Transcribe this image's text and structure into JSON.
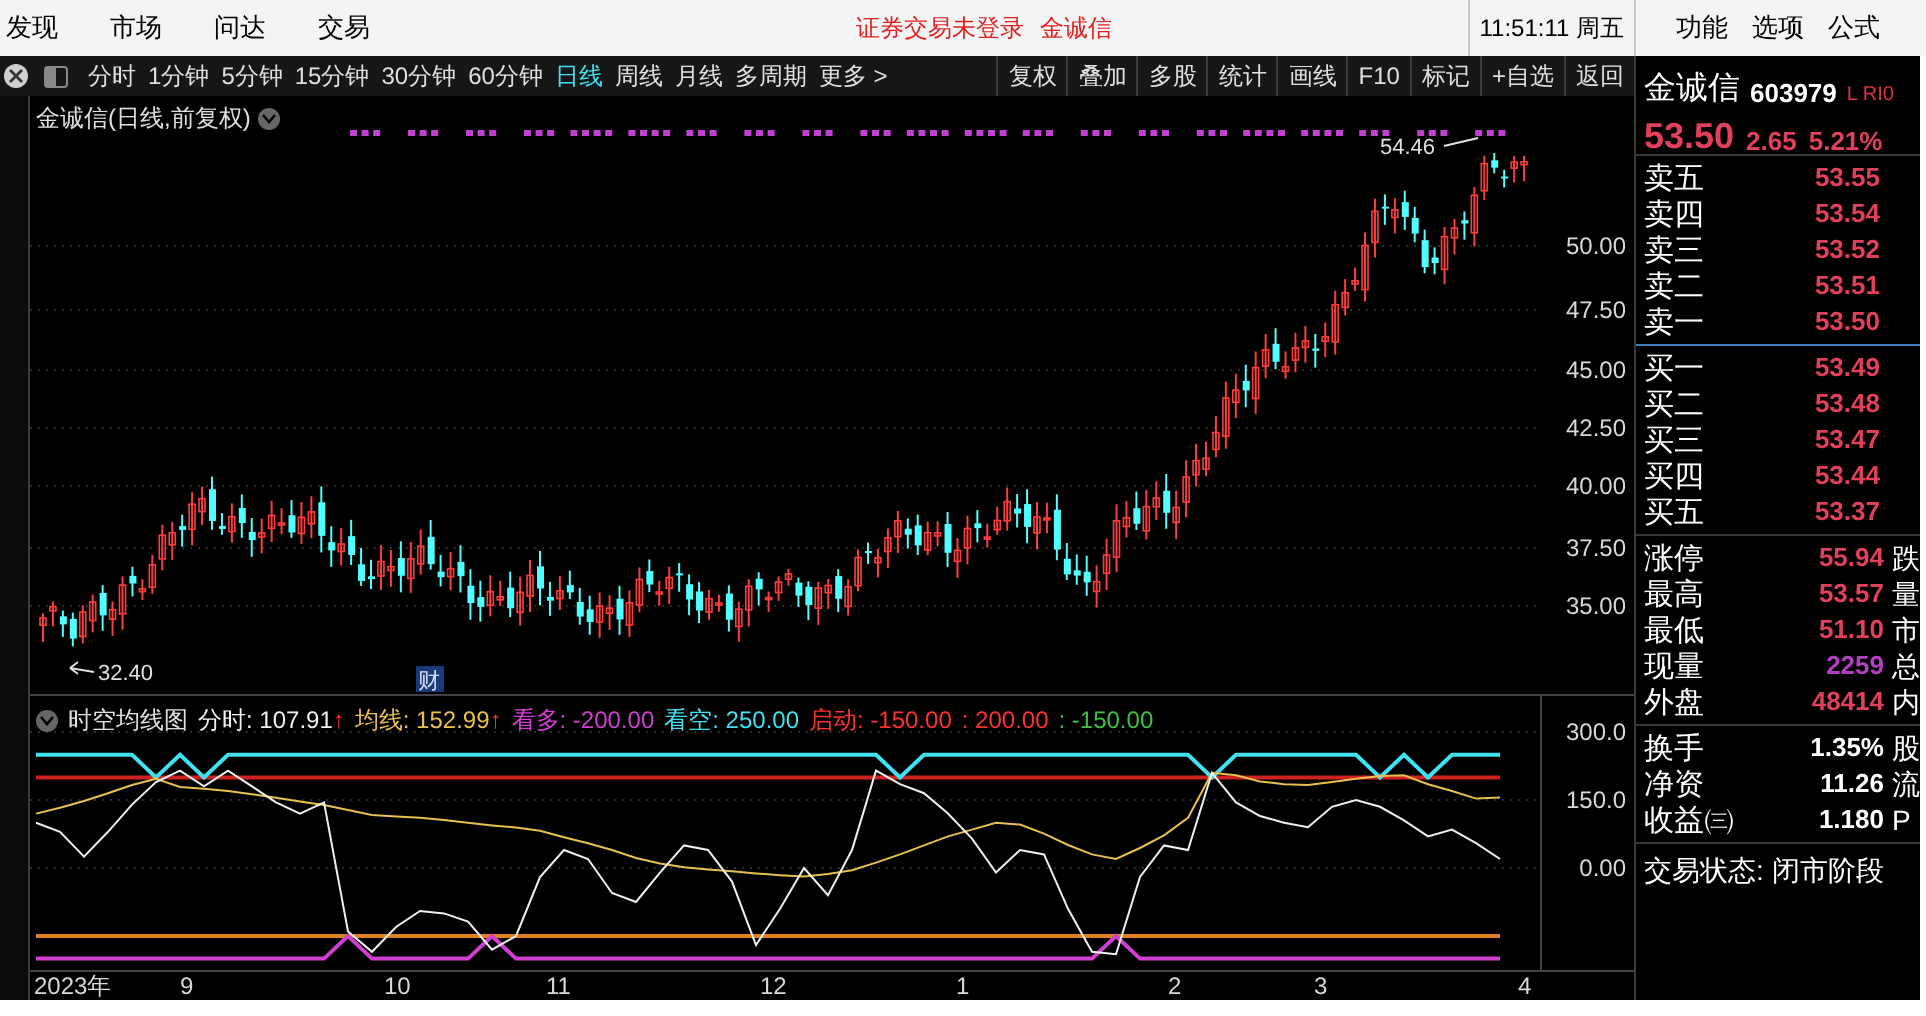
{
  "menu": {
    "items": [
      "发现",
      "市场",
      "问达",
      "交易"
    ]
  },
  "login_notice": "证券交易未登录",
  "login_stock": "金诚信",
  "clock": "11:51:11 周五",
  "top_actions": [
    "功能",
    "选项",
    "公式"
  ],
  "toolbar": {
    "periods": [
      {
        "label": "分时",
        "selected": false
      },
      {
        "label": "1分钟",
        "selected": false
      },
      {
        "label": "5分钟",
        "selected": false
      },
      {
        "label": "15分钟",
        "selected": false
      },
      {
        "label": "30分钟",
        "selected": false
      },
      {
        "label": "60分钟",
        "selected": false
      },
      {
        "label": "日线",
        "selected": true
      },
      {
        "label": "周线",
        "selected": false
      },
      {
        "label": "月线",
        "selected": false
      },
      {
        "label": "多周期",
        "selected": false
      },
      {
        "label": "更多 >",
        "selected": false
      }
    ],
    "buttons": [
      "复权",
      "叠加",
      "多股",
      "统计",
      "画线",
      "F10",
      "标记",
      "+自选",
      "返回"
    ]
  },
  "chart": {
    "title": "金诚信(日线,前复权)",
    "high_label": "54.46",
    "low_label": "32.40",
    "event_marker": "财",
    "price_axis": [
      "50.00",
      "47.50",
      "45.00",
      "42.50",
      "40.00",
      "37.50",
      "35.00"
    ],
    "indicator": {
      "name": "时空均线图",
      "legend": [
        {
          "value": ": 107.91",
          "arrow": "↑"
        },
        {
          "value": ": 152.99",
          "arrow": "↑"
        },
        {
          "value": ": -200.00"
        },
        {
          "value": ": 250.00"
        },
        {
          "value": ": -150.00"
        },
        {
          "text": ": 200.00",
          "color": "#ff3030"
        },
        {
          "text": ": -150.00",
          "color": "#40c040"
        }
      ]
    },
    "chart_data": {
      "type": "line",
      "grid": true,
      "ylim": [
        -225,
        384
      ],
      "yticks": [
        {
          "value": 300,
          "label": "300.0"
        },
        {
          "value": 150,
          "label": "150.0"
        },
        {
          "value": 0,
          "label": "0.00"
        }
      ],
      "series": [
        {
          "name": "分时",
          "color": "#f0f0f0",
          "values": [
            100,
            80,
            25,
            80,
            140,
            190,
            215,
            180,
            215,
            180,
            145,
            120,
            145,
            -140,
            -185,
            -130,
            -95,
            -100,
            -118,
            -180,
            -150,
            -20,
            40,
            20,
            -55,
            -75,
            -10,
            50,
            40,
            -30,
            -170,
            -90,
            0,
            -60,
            40,
            215,
            185,
            165,
            120,
            65,
            -10,
            40,
            30,
            -90,
            -185,
            -190,
            -20,
            50,
            40,
            210,
            145,
            115,
            100,
            90,
            135,
            150,
            135,
            105,
            70,
            85,
            55,
            20
          ]
        },
        {
          "name": "均线",
          "color": "#e8c050",
          "values": [
            120,
            133,
            148,
            165,
            183,
            197,
            179,
            175,
            170,
            163,
            155,
            147,
            139,
            128,
            117,
            114,
            111,
            106,
            100,
            94,
            89,
            82,
            68,
            55,
            40,
            22,
            10,
            2,
            -3,
            -7,
            -12,
            -16,
            -19,
            -13,
            -5,
            12,
            30,
            50,
            70,
            85,
            100,
            96,
            76,
            51,
            30,
            20,
            44,
            72,
            111,
            210,
            205,
            191,
            185,
            183,
            190,
            197,
            203,
            205,
            185,
            170,
            153,
            156
          ]
        },
        {
          "name": "看多",
          "color": "#d040d0",
          "values": [
            -200,
            -200,
            -200,
            -200,
            -200,
            -200,
            -200,
            -200,
            -200,
            -200,
            -200,
            -200,
            -200,
            -150,
            -200,
            -200,
            -200,
            -200,
            -200,
            -150,
            -200,
            -200,
            -200,
            -200,
            -200,
            -200,
            -200,
            -200,
            -200,
            -200,
            -200,
            -200,
            -200,
            -200,
            -200,
            -200,
            -200,
            -200,
            -200,
            -200,
            -200,
            -200,
            -200,
            -200,
            -200,
            -150,
            -200,
            -200,
            -200,
            -200,
            -200,
            -200,
            -200,
            -200,
            -200,
            -200,
            -200,
            -200,
            -200,
            -200,
            -200,
            -200
          ]
        },
        {
          "name": "看空",
          "color": "#40e0f0",
          "values": [
            250,
            250,
            250,
            250,
            250,
            200,
            250,
            200,
            250,
            250,
            250,
            250,
            250,
            250,
            250,
            250,
            250,
            250,
            250,
            250,
            250,
            250,
            250,
            250,
            250,
            250,
            250,
            250,
            250,
            250,
            250,
            250,
            250,
            250,
            250,
            250,
            200,
            250,
            250,
            250,
            250,
            250,
            250,
            250,
            250,
            250,
            250,
            250,
            250,
            200,
            250,
            250,
            250,
            250,
            250,
            250,
            200,
            250,
            200,
            250,
            250,
            250
          ]
        },
        {
          "name": "启动",
          "color": "#e08020",
          "values": [
            -150,
            -150,
            -150,
            -150,
            -150,
            -150,
            -150,
            -150,
            -150,
            -150,
            -150,
            -150,
            -150,
            -150,
            -150,
            -150,
            -150,
            -150,
            -150,
            -150,
            -150,
            -150,
            -150,
            -150,
            -150,
            -150,
            -150,
            -150,
            -150,
            -150,
            -150,
            -150,
            -150,
            -150,
            -150,
            -150,
            -150,
            -150,
            -150,
            -150,
            -150,
            -150,
            -150,
            -150,
            -150,
            -150,
            -150,
            -150,
            -150,
            -150,
            -150,
            -150,
            -150,
            -150,
            -150,
            -150,
            -150,
            -150,
            -150,
            -150,
            -150,
            -150
          ]
        },
        {
          "color": "#d02020",
          "values": [
            200,
            200,
            200,
            200,
            200,
            200,
            200,
            200,
            200,
            200,
            200,
            200,
            200,
            200,
            200,
            200,
            200,
            200,
            200,
            200,
            200,
            200,
            200,
            200,
            200,
            200,
            200,
            200,
            200,
            200,
            200,
            200,
            200,
            200,
            200,
            200,
            200,
            200,
            200,
            200,
            200,
            200,
            200,
            200,
            200,
            200,
            200,
            200,
            200,
            200,
            200,
            200,
            200,
            200,
            200,
            200,
            200,
            200,
            200,
            200,
            200,
            200
          ]
        }
      ]
    },
    "time_axis": [
      "2023年",
      "9",
      "10",
      "11",
      "12",
      "1",
      "2",
      "3",
      "4"
    ]
  },
  "quote": {
    "name": "金诚信",
    "code": "603979",
    "flags": "L RI0",
    "price": "53.50",
    "change": "2.65",
    "change_pct": "5.21%",
    "asks": [
      {
        "label": "卖五",
        "price": "53.55"
      },
      {
        "label": "卖四",
        "price": "53.54"
      },
      {
        "label": "卖三",
        "price": "53.52"
      },
      {
        "label": "卖二",
        "price": "53.51"
      },
      {
        "label": "卖一",
        "price": "53.50"
      }
    ],
    "bids": [
      {
        "label": "买一",
        "price": "53.49"
      },
      {
        "label": "买二",
        "price": "53.48"
      },
      {
        "label": "买三",
        "price": "53.47"
      },
      {
        "label": "买四",
        "price": "53.44"
      },
      {
        "label": "买五",
        "price": "53.37"
      }
    ],
    "stats": [
      {
        "label": "涨停",
        "value": "55.94",
        "tail": "跌",
        "color": "#e0405a"
      },
      {
        "label": "最高",
        "value": "53.57",
        "tail": "量",
        "color": "#e0405a"
      },
      {
        "label": "最低",
        "value": "51.10",
        "tail": "市",
        "color": "#e0405a"
      },
      {
        "label": "现量",
        "value": "2259",
        "tail": "总",
        "color": "#b040c0"
      },
      {
        "label": "外盘",
        "value": "48414",
        "tail": "内",
        "color": "#e0405a"
      }
    ],
    "ratios": [
      {
        "label": "换手",
        "value": "1.35%",
        "tail": "股"
      },
      {
        "label": "净资",
        "value": "11.26",
        "tail": "流"
      },
      {
        "label": "收益㈢",
        "value": "1.180",
        "tail": "P"
      }
    ],
    "trade_status": "交易状态: 闭市阶段"
  }
}
